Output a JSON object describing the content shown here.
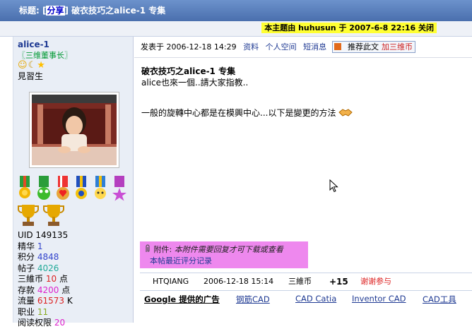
{
  "title": {
    "prefix": "标题:",
    "tag": "分享",
    "text": "破衣技巧之alice-1 专集"
  },
  "topic_closed_note": "本主题由 huhusun 于 2007-6-8 22:16 关闭",
  "user": {
    "name": "alice-1",
    "rank": "〖三维董事长〗",
    "level": "見習生",
    "stats": [
      {
        "label": "UID",
        "value": "149135",
        "unit": "",
        "color": "#000000"
      },
      {
        "label": "精华",
        "value": "1",
        "unit": "",
        "color": "#3344cc"
      },
      {
        "label": "积分",
        "value": "4848",
        "unit": "",
        "color": "#3344cc"
      },
      {
        "label": "帖子",
        "value": "4026",
        "unit": "",
        "color": "#22aa99"
      },
      {
        "label": "三維币",
        "value": "10",
        "unit": "点",
        "color": "#dd2222"
      },
      {
        "label": "存款",
        "value": "4200",
        "unit": "点",
        "color": "#dd22cc"
      },
      {
        "label": "流量",
        "value": "61573",
        "unit": "K",
        "color": "#dd2222"
      },
      {
        "label": "职业",
        "value": "11",
        "unit": "",
        "color": "#88aa22"
      },
      {
        "label": "阅读权限",
        "value": "20",
        "unit": "",
        "color": "#dd22cc"
      }
    ]
  },
  "post": {
    "posted_label": "发表于",
    "posted_time": "2006-12-18 14:29",
    "links": {
      "profile": "资料",
      "space": "个人空间",
      "message": "短消息"
    },
    "recommend": "推荐此文",
    "add_coin": "加三维币",
    "heading": "破衣技巧之alice-1 专集",
    "line1": "alice也來一個..請大家指教..",
    "line2": "一般的旋轉中心都是在模興中心...以下是變更的方法"
  },
  "attachment": {
    "label": "附件:",
    "note": "本附件需要回复才可下载或查看",
    "rating_link": "本帖最近评分记录"
  },
  "rating": {
    "user": "HTQIANG",
    "time": "2006-12-18 15:14",
    "type": "三維币",
    "score": "+15",
    "reason": "谢谢参与"
  },
  "ads": {
    "head": "Google 提供的广告",
    "links": [
      "钢筋CAD",
      "CAD Catia",
      "Inventor CAD",
      "CAD工具"
    ]
  }
}
